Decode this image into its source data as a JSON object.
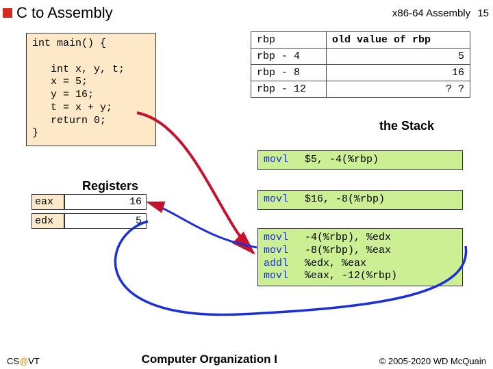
{
  "header": {
    "title": "C to Assembly",
    "topic": "x86-64 Assembly",
    "page": "15"
  },
  "code": {
    "l1": "int main() {",
    "l2": "   int x, y, t;",
    "l3": "   x = 5;",
    "l4": "   y = 16;",
    "l5": "   t = x + y;",
    "l6": "   return 0;",
    "l7": "}"
  },
  "stack": {
    "rows": [
      {
        "label": "rbp",
        "value": "old value of rbp"
      },
      {
        "label": "rbp - 4",
        "value": "5"
      },
      {
        "label": "rbp - 8",
        "value": "16"
      },
      {
        "label": "rbp - 12",
        "value": "? ?"
      }
    ],
    "caption": "the Stack"
  },
  "registers": {
    "title": "Registers",
    "eax": {
      "name": "eax",
      "value": "16"
    },
    "edx": {
      "name": "edx",
      "value": "5"
    }
  },
  "asm": {
    "block1": {
      "op0": "movl",
      "arg0": "$5, -4(%rbp)"
    },
    "block2": {
      "op0": "movl",
      "arg0": "$16, -8(%rbp)"
    },
    "block3": {
      "op0": "movl",
      "arg0": "-4(%rbp), %edx",
      "op1": "movl",
      "arg1": "-8(%rbp), %eax",
      "op2": "addl",
      "arg2": "%edx, %eax",
      "op3": "movl",
      "arg3": "%eax, -12(%rbp)"
    }
  },
  "footer": {
    "left_pre": "CS",
    "left_at": "@",
    "left_post": "VT",
    "mid": "Computer Organization I",
    "right": "© 2005-2020 WD McQuain"
  }
}
